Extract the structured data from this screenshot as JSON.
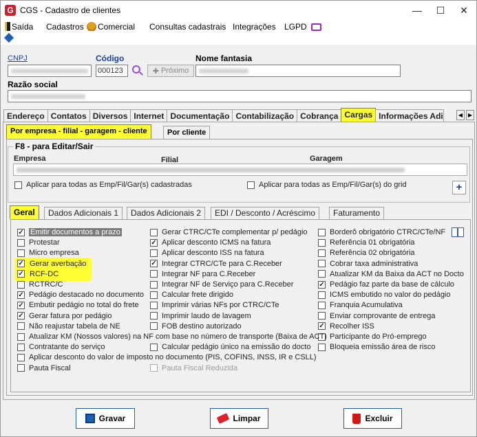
{
  "window": {
    "title": "CGS - Cadastro de clientes",
    "minimize": "—",
    "maximize": "☐",
    "close": "✕"
  },
  "menu": {
    "items": [
      "Saída",
      "Cadastros",
      "Comercial",
      "Consultas cadastrais",
      "Integrações",
      "LGPD"
    ]
  },
  "header": {
    "cnpj_label": "CNPJ",
    "codigo_label": "Código",
    "codigo_value": "000123",
    "nome_fantasia_label": "Nome fantasia",
    "proximo_label": "Próximo",
    "razao_social_label": "Razão social"
  },
  "tabs": [
    "Endereço",
    "Contatos",
    "Diversos",
    "Internet",
    "Documentação",
    "Contabilização",
    "Cobrança",
    "Cargas",
    "Informações Adi"
  ],
  "subtabs": {
    "left": "Por empresa - filial - garagem - cliente",
    "right": "Por cliente"
  },
  "group": {
    "label": "F8 - para Editar/Sair",
    "empresa_label": "Empresa",
    "filial_label": "Filial",
    "garagem_label": "Garagem",
    "apply_all": "Aplicar para todas as Emp/Fil/Gar(s) cadastradas",
    "apply_grid": "Aplicar para todas as Emp/Fil/Gar(s) do grid"
  },
  "inner_tabs": [
    "Geral",
    "Dados Adicionais 1",
    "Dados Adicionais 2",
    "EDI / Desconto / Acréscimo",
    "Faturamento"
  ],
  "options": {
    "c1": [
      {
        "label": "Emitir documentos a prazo",
        "checked": true
      },
      {
        "label": "Protestar",
        "checked": false
      },
      {
        "label": "Micro empresa",
        "checked": false
      },
      {
        "label": "Gerar averbação",
        "checked": true
      },
      {
        "label": "RCF-DC",
        "checked": true
      },
      {
        "label": "RCTRC/C",
        "checked": false
      },
      {
        "label": "Pedágio destacado no documento",
        "checked": true
      },
      {
        "label": "Embutir pedágio no total do frete",
        "checked": true
      },
      {
        "label": "Gerar fatura por pedágio",
        "checked": true
      },
      {
        "label": "Não reajustar tabela de NE",
        "checked": false
      }
    ],
    "c2": [
      {
        "label": "Gerar CTRC/CTe complementar p/ pedágio",
        "checked": false
      },
      {
        "label": "Aplicar desconto ICMS na fatura",
        "checked": true
      },
      {
        "label": "Aplicar desconto ISS na fatura",
        "checked": false
      },
      {
        "label": "Integrar CTRC/CTe para C.Receber",
        "checked": true
      },
      {
        "label": "Integrar NF para C.Receber",
        "checked": false
      },
      {
        "label": "Integrar NF de Serviço para C.Receber",
        "checked": false
      },
      {
        "label": "Calcular frete dirigido",
        "checked": false
      },
      {
        "label": "Imprimir várias NFs por CTRC/CTe",
        "checked": false
      },
      {
        "label": "Imprimir laudo de lavagem",
        "checked": false
      },
      {
        "label": "FOB destino autorizado",
        "checked": false
      }
    ],
    "c3": [
      {
        "label": "Borderô obrigatório  CTRC/CTe/NF",
        "checked": false
      },
      {
        "label": "Referência 01 obrigatória",
        "checked": false
      },
      {
        "label": "Referência 02 obrigatória",
        "checked": false
      },
      {
        "label": "Cobrar taxa administrativa",
        "checked": false
      },
      {
        "label": "Atualizar KM da Baixa da ACT no Docto",
        "checked": false
      },
      {
        "label": "Pedágio faz parte da base de cálculo",
        "checked": true
      },
      {
        "label": "ICMS embutido no valor do pedágio",
        "checked": false
      },
      {
        "label": "Franquia Acumulativa",
        "checked": false
      },
      {
        "label": "Enviar comprovante de entrega",
        "checked": false
      },
      {
        "label": "Recolher ISS",
        "checked": true
      },
      {
        "label": "Participante do Pró-emprego",
        "checked": false
      },
      {
        "label": "Bloqueia emissão área de risco",
        "checked": false
      }
    ],
    "wide": [
      {
        "label": "Atualizar KM (Nossos valores) na NF com base no número de transporte (Baixa de ACT)",
        "checked": false
      },
      {
        "label": "Contratante do serviço",
        "checked": false
      },
      {
        "label": "Aplicar desconto do valor de imposto no documento (PIS, COFINS, INSS, IR e CSLL)",
        "checked": false
      },
      {
        "label": "Pauta Fiscal",
        "checked": false
      }
    ],
    "mid_extra": [
      {
        "label": "Calcular pedágio único na emissão do docto",
        "checked": false
      },
      {
        "label": "Pauta Fiscal Reduzida",
        "checked": false
      }
    ]
  },
  "buttons": {
    "gravar": "Gravar",
    "limpar": "Limpar",
    "excluir": "Excluir"
  }
}
